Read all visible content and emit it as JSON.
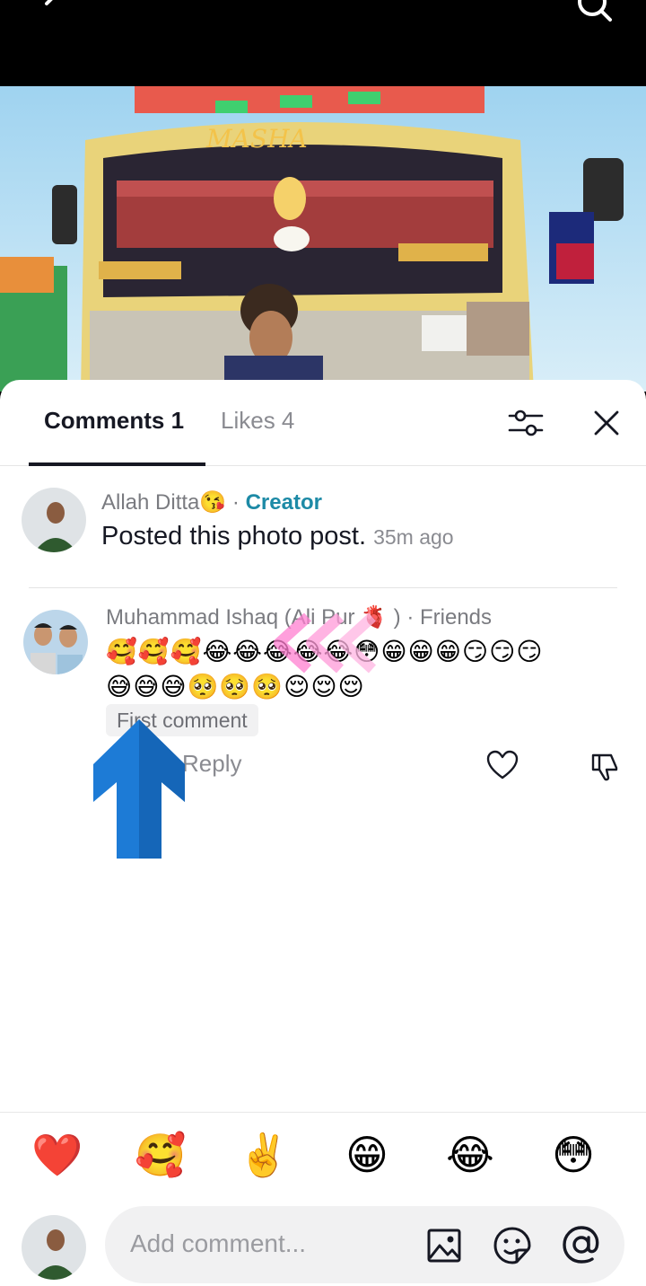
{
  "tabs": {
    "comments_label": "Comments 1",
    "likes_label": "Likes 4"
  },
  "comments": [
    {
      "author": "Allah Ditta😘",
      "separator": " · ",
      "role": "Creator",
      "text": "Posted this photo post.",
      "time": "35m ago"
    },
    {
      "author": "Muhammad Ishaq (Ali Pur 🫀 )",
      "separator": " · ",
      "role": "Friends",
      "text_line1": "🥰🥰🥰😂😂😂😂😂😳😁😁😁😏😏😏",
      "text_line2": "😅😅😅🥺🥺🥺😌😌😌",
      "badge": "First comment",
      "reply_label": "Reply"
    }
  ],
  "quick_emojis": [
    "❤️",
    "🥰",
    "✌️",
    "😁",
    "😂",
    "😳"
  ],
  "composer": {
    "placeholder": "Add comment..."
  },
  "icons": {
    "filter": "sliders-icon",
    "close": "close-icon",
    "like": "heart-icon",
    "dislike": "thumbs-down-icon",
    "image": "image-icon",
    "sticker": "sticker-icon",
    "mention": "at-mention-icon"
  },
  "colors": {
    "creator_accent": "#1d8aa6",
    "text_primary": "#161823",
    "text_secondary": "#8a8b91"
  }
}
